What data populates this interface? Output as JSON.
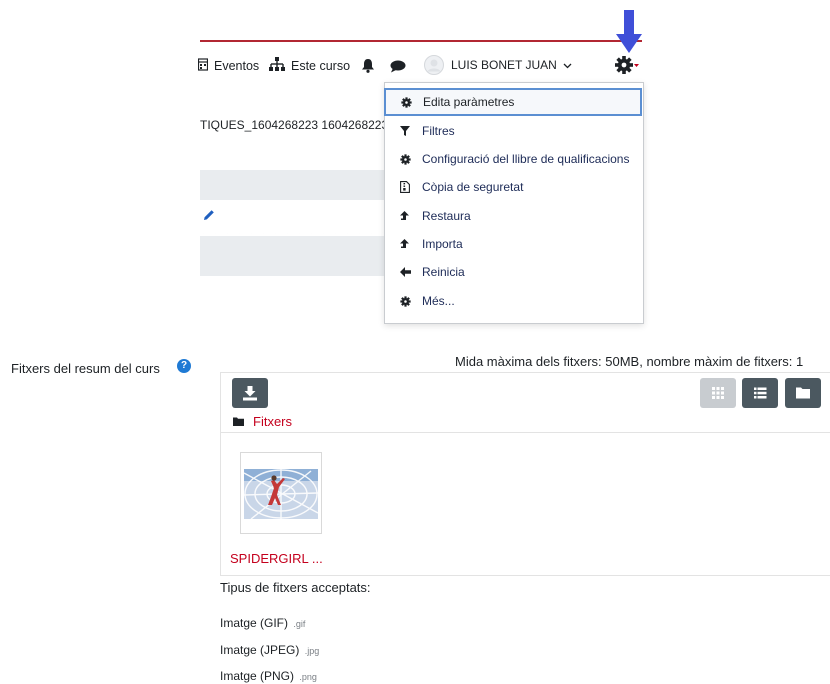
{
  "header": {
    "nav_eventos": "Eventos",
    "nav_este_curso": "Este curso",
    "user_name": "LUIS BONET JUAN",
    "course_id_text": "TIQUES_1604268223 1604268223"
  },
  "menu": {
    "items": [
      {
        "label": "Edita paràmetres",
        "icon": "gear-icon"
      },
      {
        "label": "Filtres",
        "icon": "filter-icon"
      },
      {
        "label": "Configuració del llibre de qualificacions",
        "icon": "gear-icon"
      },
      {
        "label": "Còpia de seguretat",
        "icon": "file-archive-icon"
      },
      {
        "label": "Restaura",
        "icon": "upload-arrow-icon"
      },
      {
        "label": "Importa",
        "icon": "upload-arrow-icon"
      },
      {
        "label": "Reinicia",
        "icon": "arrow-left-icon"
      },
      {
        "label": "Més...",
        "icon": "gear-icon"
      }
    ]
  },
  "form": {
    "files_label": "Fitxers del resum del curs",
    "max_info": "Mida màxima dels fitxers: 50MB, nombre màxim de fitxers: 1",
    "folder_name": "Fitxers",
    "file_name": "SPIDERGIRL ...",
    "accepted_title": "Tipus de fitxers acceptats:",
    "accepted": [
      {
        "name": "Imatge (GIF)",
        "ext": ".gif"
      },
      {
        "name": "Imatge (JPEG)",
        "ext": ".jpg"
      },
      {
        "name": "Imatge (PNG)",
        "ext": ".png"
      }
    ]
  },
  "colors": {
    "accent_red": "#c4001d",
    "arrow_blue": "#3f4fd8",
    "help_blue": "#1f7ad4",
    "button_dark": "#4b5860"
  }
}
